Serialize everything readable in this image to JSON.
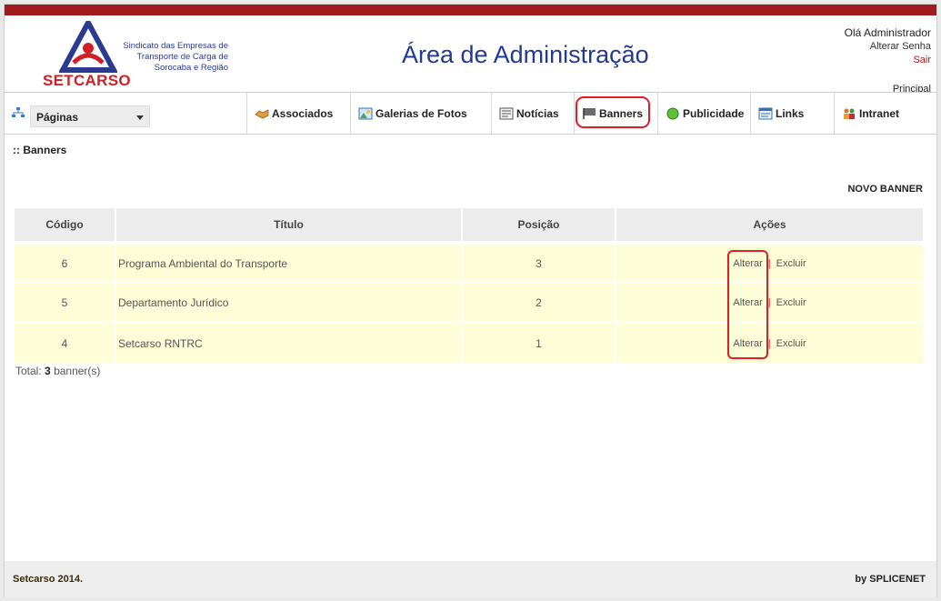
{
  "header": {
    "logo_name": "SETCARSO",
    "logo_desc": "Sindicato das Empresas de Transporte de Carga de Sorocaba e Região",
    "title": "Área de Administração",
    "greeting": "Olá Administrador",
    "change_password": "Alterar Senha",
    "logout": "Sair",
    "principal": "Principal"
  },
  "nav": {
    "pages_select": "Páginas",
    "items": [
      {
        "label": "Associados",
        "icon": "handshake-icon"
      },
      {
        "label": "Galerias de Fotos",
        "icon": "photo-gallery-icon"
      },
      {
        "label": "Notícias",
        "icon": "news-icon"
      },
      {
        "label": "Banners",
        "icon": "banner-icon"
      },
      {
        "label": "Publicidade",
        "icon": "publicity-icon"
      },
      {
        "label": "Links",
        "icon": "links-icon"
      },
      {
        "label": "Intranet",
        "icon": "intranet-icon"
      }
    ]
  },
  "section_title": ":: Banners",
  "new_banner": "NOVO BANNER",
  "table": {
    "headers": [
      "Código",
      "Título",
      "Posição",
      "Ações"
    ],
    "rows": [
      {
        "codigo": "6",
        "titulo": "Programa Ambiental do Transporte",
        "posicao": "3",
        "alterar": "Alterar",
        "excluir": "Excluir"
      },
      {
        "codigo": "5",
        "titulo": "Departamento Jurídico",
        "posicao": "2",
        "alterar": "Alterar",
        "excluir": "Excluir"
      },
      {
        "codigo": "4",
        "titulo": "Setcarso RNTRC",
        "posicao": "1",
        "alterar": "Alterar",
        "excluir": "Excluir"
      }
    ],
    "separator": "|"
  },
  "total": {
    "prefix": "Total:",
    "count": "3",
    "suffix": "banner(s)"
  },
  "footer": {
    "left": "Setcarso 2014.",
    "right": "by SPLICENET"
  },
  "colors": {
    "accent_red": "#a11a1d",
    "title_blue": "#233a8e",
    "row_yellow": "#fdfdd8"
  }
}
